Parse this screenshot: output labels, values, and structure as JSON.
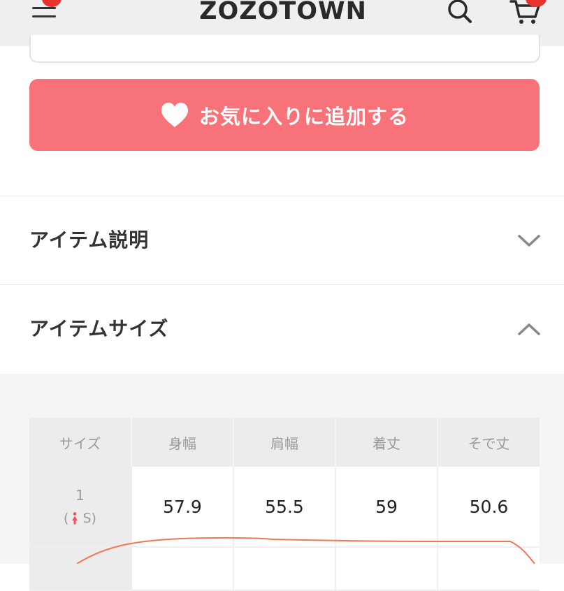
{
  "header": {
    "logo": "ZOZOTOWN",
    "menu_icon": "hamburger-menu-icon",
    "search_icon": "magnifier-icon",
    "cart_icon": "shopping-cart-icon",
    "badge_color": "#e8322f"
  },
  "favorite_button": {
    "label": "お気に入りに追加する",
    "icon": "heart-icon",
    "color": "#f87279"
  },
  "sections": [
    {
      "title": "アイテム説明",
      "expanded": false
    },
    {
      "title": "アイテムサイズ",
      "expanded": true
    }
  ],
  "size_table": {
    "headers": [
      "サイズ",
      "身幅",
      "肩幅",
      "着丈",
      "そで丈"
    ],
    "rows": [
      {
        "size": "1",
        "note_open": "(",
        "note_close": "S)",
        "values": [
          "57.9",
          "55.5",
          "59",
          "50.6"
        ]
      }
    ]
  },
  "annotation_color": "#f07850"
}
